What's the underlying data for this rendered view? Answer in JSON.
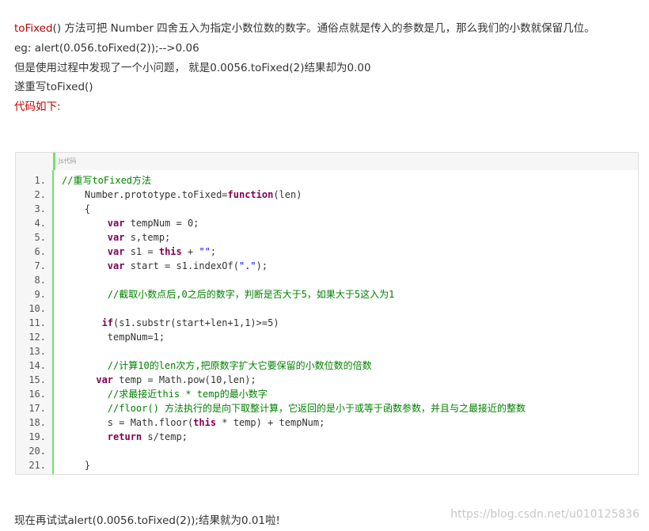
{
  "intro": {
    "line1_fn": "toFixed",
    "line1_rest": "() 方法可把 Number 四舍五入为指定小数位数的数字。通俗点就是传入的参数是几，那么我们的小数就保留几位。",
    "line2": "eg: alert(0.056.toFixed(2));-->0.06",
    "line3": "但是使用过程中发现了一个小问题， 就是0.0056.toFixed(2)结果却为0.00",
    "line4": "遂重写toFixed()",
    "line5": "代码如下:"
  },
  "code_block": {
    "language_label": "Js代码",
    "lines": [
      {
        "n": "1.",
        "tokens": [
          [
            "cm",
            "//重写toFixed方法"
          ]
        ]
      },
      {
        "n": "2.",
        "tokens": [
          [
            "",
            "    Number.prototype.toFixed="
          ],
          [
            "kw",
            "function"
          ],
          [
            "",
            "(len)"
          ]
        ]
      },
      {
        "n": "3.",
        "tokens": [
          [
            "",
            "    {"
          ]
        ]
      },
      {
        "n": "4.",
        "tokens": [
          [
            "",
            "        "
          ],
          [
            "kw",
            "var"
          ],
          [
            "",
            " tempNum = 0;"
          ]
        ]
      },
      {
        "n": "5.",
        "tokens": [
          [
            "",
            "        "
          ],
          [
            "kw",
            "var"
          ],
          [
            "",
            " s,temp;"
          ]
        ]
      },
      {
        "n": "6.",
        "tokens": [
          [
            "",
            "        "
          ],
          [
            "kw",
            "var"
          ],
          [
            "",
            " s1 = "
          ],
          [
            "kw",
            "this"
          ],
          [
            "",
            " + "
          ],
          [
            "st",
            "\"\""
          ],
          [
            "",
            ";"
          ]
        ]
      },
      {
        "n": "7.",
        "tokens": [
          [
            "",
            "        "
          ],
          [
            "kw",
            "var"
          ],
          [
            "",
            " start = s1.indexOf("
          ],
          [
            "st",
            "\".\""
          ],
          [
            "",
            ");"
          ]
        ]
      },
      {
        "n": "8.",
        "tokens": [
          [
            "",
            ""
          ]
        ]
      },
      {
        "n": "9.",
        "tokens": [
          [
            "",
            "        "
          ],
          [
            "cm",
            "//截取小数点后,0之后的数字，判断是否大于5，如果大于5这入为1"
          ]
        ]
      },
      {
        "n": "10.",
        "tokens": [
          [
            "",
            ""
          ]
        ]
      },
      {
        "n": "11.",
        "tokens": [
          [
            "",
            "       "
          ],
          [
            "kw",
            "if"
          ],
          [
            "",
            "(s1.substr(start+len+1,1)>=5)"
          ]
        ]
      },
      {
        "n": "12.",
        "tokens": [
          [
            "",
            "        tempNum=1;"
          ]
        ]
      },
      {
        "n": "13.",
        "tokens": [
          [
            "",
            ""
          ]
        ]
      },
      {
        "n": "14.",
        "tokens": [
          [
            "",
            "        "
          ],
          [
            "cm",
            "//计算10的len次方,把原数字扩大它要保留的小数位数的倍数"
          ]
        ]
      },
      {
        "n": "15.",
        "tokens": [
          [
            "",
            "      "
          ],
          [
            "kw",
            "var"
          ],
          [
            "",
            " temp = Math.pow(10,len);"
          ]
        ]
      },
      {
        "n": "16.",
        "tokens": [
          [
            "",
            "        "
          ],
          [
            "cm",
            "//求最接近this * temp的最小数字"
          ]
        ]
      },
      {
        "n": "17.",
        "tokens": [
          [
            "",
            "        "
          ],
          [
            "cm",
            "//floor() 方法执行的是向下取整计算，它返回的是小于或等于函数参数，并且与之最接近的整数"
          ]
        ]
      },
      {
        "n": "18.",
        "tokens": [
          [
            "",
            "        s = Math.floor("
          ],
          [
            "kw",
            "this"
          ],
          [
            "",
            " * temp) + tempNum;"
          ]
        ]
      },
      {
        "n": "19.",
        "tokens": [
          [
            "",
            "        "
          ],
          [
            "kw",
            "return"
          ],
          [
            "",
            " s/temp;"
          ]
        ]
      },
      {
        "n": "20.",
        "tokens": [
          [
            "",
            ""
          ]
        ]
      },
      {
        "n": "21.",
        "tokens": [
          [
            "",
            "    }"
          ]
        ]
      }
    ]
  },
  "outro": "现在再试试alert(0.0056.toFixed(2));结果就为0.01啦!",
  "watermark": "https://blog.csdn.net/u010125836"
}
